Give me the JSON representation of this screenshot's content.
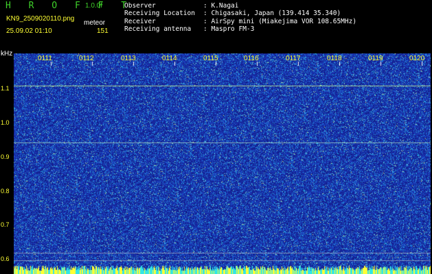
{
  "header": {
    "brand": "H R O F F T",
    "version": "1.0.0f",
    "filename": "KN9_2509020110.png",
    "mode": "meteor",
    "datetime": "25.09.02 01:10",
    "count": "151",
    "meta": [
      {
        "key": "Observer",
        "value": ": K.Nagai"
      },
      {
        "key": "Receiving Location",
        "value": ": Chigasaki, Japan (139.414 35.340)"
      },
      {
        "key": "Receiver",
        "value": ": AirSpy mini (Miakejima VOR 108.65MHz)"
      },
      {
        "key": "Receiving antenna",
        "value": ": Maspro FM-3"
      }
    ]
  },
  "axis": {
    "y_unit": "kHz",
    "y_ticks": [
      "1.1",
      "1.0",
      "0.9",
      "0.8",
      "0.7",
      "0.6"
    ],
    "x_labels": [
      "0111",
      "0112",
      "0113",
      "0114",
      "0115",
      "0116",
      "0117",
      "0118",
      "0119",
      "0120"
    ]
  },
  "colors": {
    "background": "#1a2fa8",
    "accent_yellow": "#ffff33",
    "accent_green": "#3fd12a"
  }
}
